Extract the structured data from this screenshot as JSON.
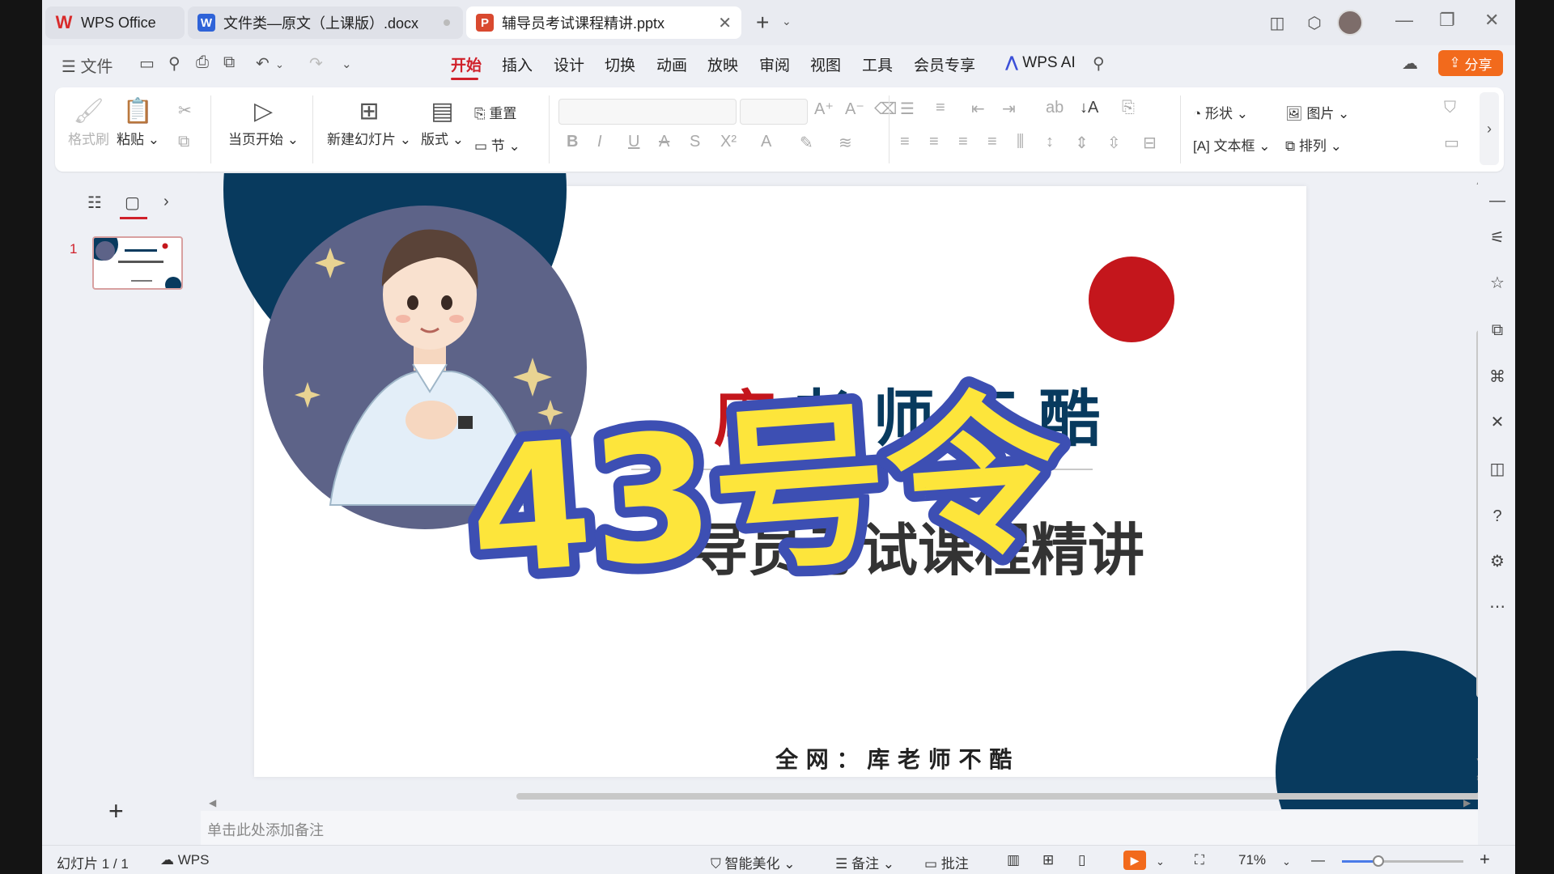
{
  "tabs": {
    "home": "WPS Office",
    "doc": "文件类—原文（上课版）.docx",
    "ppt": "辅导员考试课程精讲.pptx"
  },
  "menu": {
    "file": "文件",
    "items": [
      "开始",
      "插入",
      "设计",
      "切换",
      "动画",
      "放映",
      "审阅",
      "视图",
      "工具",
      "会员专享"
    ],
    "ai": "WPS AI",
    "share": "分享"
  },
  "ribbon": {
    "format_painter": "格式刷",
    "paste": "粘贴",
    "start_current": "当页开始",
    "new_slide": "新建幻灯片",
    "layout": "版式",
    "reset": "重置",
    "section": "节",
    "shape": "形状",
    "picture": "图片",
    "textbox": "文本框",
    "arrange": "排列"
  },
  "slides_panel": {
    "slide_number": "1"
  },
  "slide": {
    "title_first": "库",
    "title_rest": "老 师 不 酷",
    "subtitle_hidden": "导员考试课程精讲",
    "overlay": "43号令",
    "footer": "全 网 ： 库 老 师 不 酷",
    "colors": {
      "navy": "#083a5e",
      "red": "#c4161c",
      "circle_bg": "#5d6388",
      "overlay_fill": "#fde53b",
      "overlay_stroke": "#3d4fb3"
    }
  },
  "notes_placeholder": "单击此处添加备注",
  "status": {
    "slide_info": "幻灯片 1 / 1",
    "app": "WPS",
    "beautify": "智能美化",
    "notes": "备注",
    "comments": "批注",
    "zoom_label": "71%",
    "zoom_value": 0.3
  },
  "accent_color": "#d0202a",
  "icons": [
    "wps-logo-icon",
    "word-icon",
    "ppt-icon",
    "save-icon",
    "print-icon",
    "undo-icon",
    "redo-icon",
    "search-icon",
    "cloud-icon",
    "play-icon",
    "zoom-in-icon",
    "zoom-out-icon"
  ]
}
